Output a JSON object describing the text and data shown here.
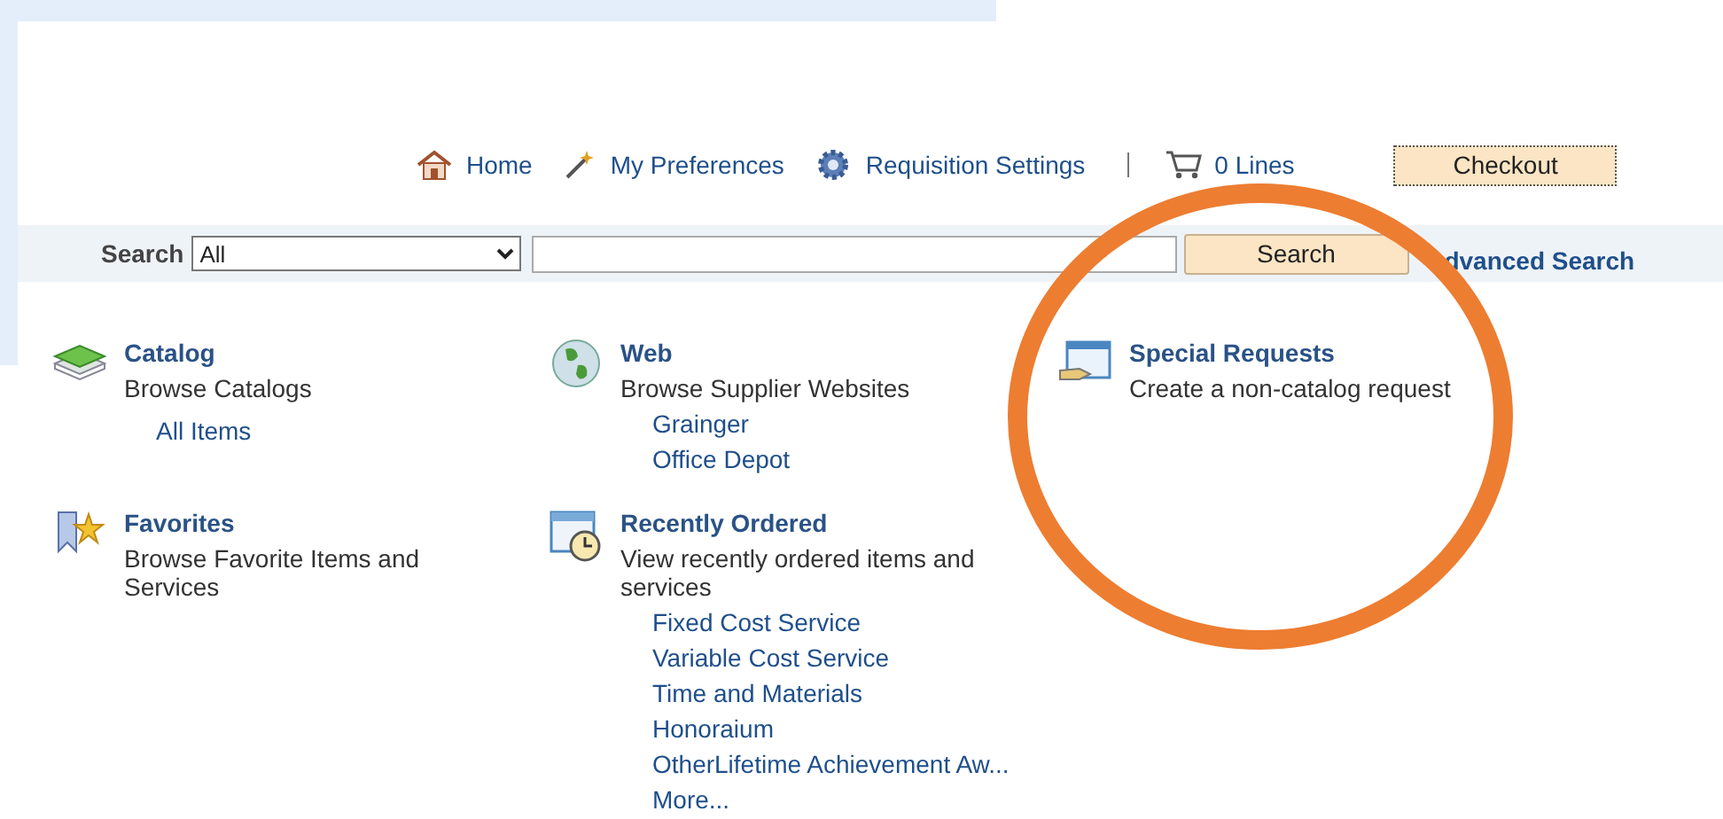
{
  "toolbar": {
    "links": [
      {
        "kind": "home",
        "label": "Home"
      },
      {
        "kind": "preferences",
        "label": "My Preferences"
      },
      {
        "kind": "settings",
        "label": "Requisition Settings"
      }
    ],
    "cart": {
      "label": "0 Lines"
    },
    "checkout": "Checkout"
  },
  "search": {
    "label": "Search",
    "scope": "All",
    "button": "Search",
    "advanced": "dvanced Search"
  },
  "sections": [
    {
      "kind": "catalog",
      "title": "Catalog",
      "description": "Browse Catalogs",
      "links": [
        "All Items"
      ]
    },
    {
      "kind": "web",
      "title": "Web",
      "description": "Browse Supplier Websites",
      "links": [
        "Grainger",
        "Office Depot"
      ]
    },
    {
      "kind": "special",
      "title": "Special Requests",
      "description": "Create a non-catalog request"
    },
    {
      "kind": "favorites",
      "title": "Favorites",
      "description": "Browse Favorite Items and Services"
    },
    {
      "kind": "recent",
      "title": "Recently Ordered",
      "description": "View recently ordered items and services",
      "links": [
        "Fixed Cost Service",
        "Variable Cost Service",
        "Time and Materials",
        "Honoraium",
        "OtherLifetime Achievement Aw...",
        "More..."
      ]
    }
  ],
  "annotation": {
    "kind": "ring",
    "color": "#ed7d31"
  }
}
